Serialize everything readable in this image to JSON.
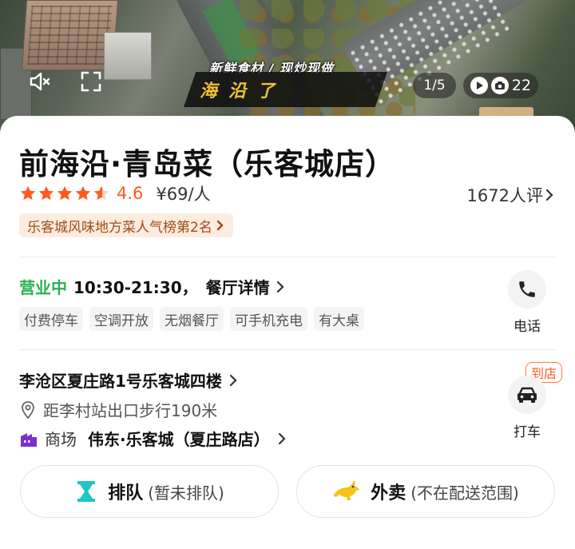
{
  "hero": {
    "caption_top": "新鲜食材 / 现炒现做",
    "caption_main": "海沿了",
    "page_counter": "1/5",
    "media_count": "22",
    "mute_icon": "speaker-mute-icon",
    "fullscreen_icon": "fullscreen-icon",
    "video_icon": "play-circle-icon",
    "photo_icon": "camera-circle-icon"
  },
  "shop": {
    "title": "前海沿·青岛菜（乐客城店）",
    "rating_stars": 4.6,
    "score": "4.6",
    "price": "¥69/人",
    "reviews": "1672人评",
    "rank_badge": "乐客城风味地方菜人气榜第2名"
  },
  "hours": {
    "status": "营业中",
    "time": "10:30-21:30，",
    "detail_link": "餐厅详情"
  },
  "tags": [
    "付费停车",
    "空调开放",
    "无烟餐厅",
    "可手机充电",
    "有大桌"
  ],
  "actions": {
    "phone_label": "电话",
    "taxi_label": "打车",
    "taxi_badge": "到店"
  },
  "address": {
    "line": "李沧区夏庄路1号乐客城四楼",
    "distance": "距李村站出口步行190米",
    "mall_type": "商场",
    "mall_name": "伟东·乐客城（夏庄路店）"
  },
  "buttons": {
    "queue_label": "排队",
    "queue_status": "(暂未排队)",
    "delivery_label": "外卖",
    "delivery_status": "(不在配送范围)"
  },
  "colors": {
    "accent_orange": "#ff5a1f",
    "open_green": "#2bb152",
    "queue_teal": "#1fc6c6",
    "delivery_yellow": "#f6c21b",
    "mall_purple": "#7b2fd1"
  }
}
